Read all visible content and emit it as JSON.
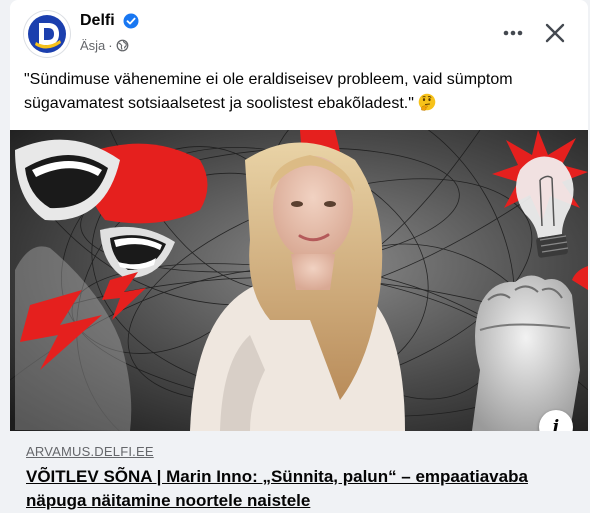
{
  "post": {
    "author": "Delfi",
    "time": "Äsja",
    "separator": "·",
    "audience_icon": "globe-icon",
    "text": "\"Sündimuse vähenemine ei ole eraldiseisev probleem, vaid sümptom sügavamatest sotsiaalsetest ja soolistest ebakõladest.\"",
    "emoji": "thinking-face-icon"
  },
  "link_preview": {
    "domain": "ARVAMUS.DELFI.EE",
    "title": "VÕITLEV SÕNA | Marin Inno: „Sünnita, palun“ – empaatiavaba näpuga näitamine noortele naistele",
    "info_label": "i"
  },
  "colors": {
    "brand": "#1b3fae",
    "verified": "#1877f2",
    "accent_red": "#e5201e",
    "link_bg": "#f0f2f5"
  }
}
